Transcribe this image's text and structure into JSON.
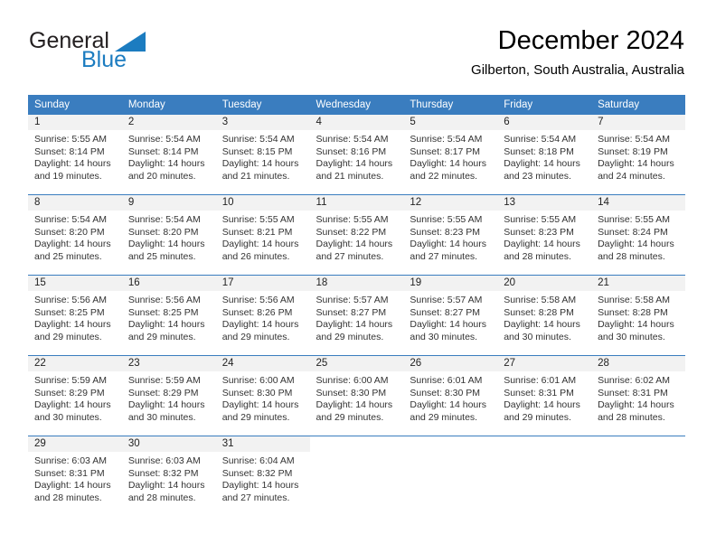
{
  "brand": {
    "name_part1": "General",
    "name_part2": "Blue",
    "triangle_color": "#1c7cc0",
    "text_color": "#231f20"
  },
  "header": {
    "title": "December 2024",
    "location": "Gilberton, South Australia, Australia"
  },
  "theme": {
    "header_bg": "#3a7dbf",
    "header_text": "#ffffff",
    "daynum_bg": "#f2f2f2",
    "row_divider": "#3a7dbf",
    "body_text": "#333333"
  },
  "weekday_headers": [
    "Sunday",
    "Monday",
    "Tuesday",
    "Wednesday",
    "Thursday",
    "Friday",
    "Saturday"
  ],
  "labels": {
    "sunrise_prefix": "Sunrise:",
    "sunset_prefix": "Sunset:",
    "daylight_prefix": "Daylight:"
  },
  "weeks": [
    {
      "days": [
        {
          "num": "1",
          "sunrise": "Sunrise: 5:55 AM",
          "sunset": "Sunset: 8:14 PM",
          "daylight_l1": "Daylight: 14 hours",
          "daylight_l2": "and 19 minutes."
        },
        {
          "num": "2",
          "sunrise": "Sunrise: 5:54 AM",
          "sunset": "Sunset: 8:14 PM",
          "daylight_l1": "Daylight: 14 hours",
          "daylight_l2": "and 20 minutes."
        },
        {
          "num": "3",
          "sunrise": "Sunrise: 5:54 AM",
          "sunset": "Sunset: 8:15 PM",
          "daylight_l1": "Daylight: 14 hours",
          "daylight_l2": "and 21 minutes."
        },
        {
          "num": "4",
          "sunrise": "Sunrise: 5:54 AM",
          "sunset": "Sunset: 8:16 PM",
          "daylight_l1": "Daylight: 14 hours",
          "daylight_l2": "and 21 minutes."
        },
        {
          "num": "5",
          "sunrise": "Sunrise: 5:54 AM",
          "sunset": "Sunset: 8:17 PM",
          "daylight_l1": "Daylight: 14 hours",
          "daylight_l2": "and 22 minutes."
        },
        {
          "num": "6",
          "sunrise": "Sunrise: 5:54 AM",
          "sunset": "Sunset: 8:18 PM",
          "daylight_l1": "Daylight: 14 hours",
          "daylight_l2": "and 23 minutes."
        },
        {
          "num": "7",
          "sunrise": "Sunrise: 5:54 AM",
          "sunset": "Sunset: 8:19 PM",
          "daylight_l1": "Daylight: 14 hours",
          "daylight_l2": "and 24 minutes."
        }
      ]
    },
    {
      "days": [
        {
          "num": "8",
          "sunrise": "Sunrise: 5:54 AM",
          "sunset": "Sunset: 8:20 PM",
          "daylight_l1": "Daylight: 14 hours",
          "daylight_l2": "and 25 minutes."
        },
        {
          "num": "9",
          "sunrise": "Sunrise: 5:54 AM",
          "sunset": "Sunset: 8:20 PM",
          "daylight_l1": "Daylight: 14 hours",
          "daylight_l2": "and 25 minutes."
        },
        {
          "num": "10",
          "sunrise": "Sunrise: 5:55 AM",
          "sunset": "Sunset: 8:21 PM",
          "daylight_l1": "Daylight: 14 hours",
          "daylight_l2": "and 26 minutes."
        },
        {
          "num": "11",
          "sunrise": "Sunrise: 5:55 AM",
          "sunset": "Sunset: 8:22 PM",
          "daylight_l1": "Daylight: 14 hours",
          "daylight_l2": "and 27 minutes."
        },
        {
          "num": "12",
          "sunrise": "Sunrise: 5:55 AM",
          "sunset": "Sunset: 8:23 PM",
          "daylight_l1": "Daylight: 14 hours",
          "daylight_l2": "and 27 minutes."
        },
        {
          "num": "13",
          "sunrise": "Sunrise: 5:55 AM",
          "sunset": "Sunset: 8:23 PM",
          "daylight_l1": "Daylight: 14 hours",
          "daylight_l2": "and 28 minutes."
        },
        {
          "num": "14",
          "sunrise": "Sunrise: 5:55 AM",
          "sunset": "Sunset: 8:24 PM",
          "daylight_l1": "Daylight: 14 hours",
          "daylight_l2": "and 28 minutes."
        }
      ]
    },
    {
      "days": [
        {
          "num": "15",
          "sunrise": "Sunrise: 5:56 AM",
          "sunset": "Sunset: 8:25 PM",
          "daylight_l1": "Daylight: 14 hours",
          "daylight_l2": "and 29 minutes."
        },
        {
          "num": "16",
          "sunrise": "Sunrise: 5:56 AM",
          "sunset": "Sunset: 8:25 PM",
          "daylight_l1": "Daylight: 14 hours",
          "daylight_l2": "and 29 minutes."
        },
        {
          "num": "17",
          "sunrise": "Sunrise: 5:56 AM",
          "sunset": "Sunset: 8:26 PM",
          "daylight_l1": "Daylight: 14 hours",
          "daylight_l2": "and 29 minutes."
        },
        {
          "num": "18",
          "sunrise": "Sunrise: 5:57 AM",
          "sunset": "Sunset: 8:27 PM",
          "daylight_l1": "Daylight: 14 hours",
          "daylight_l2": "and 29 minutes."
        },
        {
          "num": "19",
          "sunrise": "Sunrise: 5:57 AM",
          "sunset": "Sunset: 8:27 PM",
          "daylight_l1": "Daylight: 14 hours",
          "daylight_l2": "and 30 minutes."
        },
        {
          "num": "20",
          "sunrise": "Sunrise: 5:58 AM",
          "sunset": "Sunset: 8:28 PM",
          "daylight_l1": "Daylight: 14 hours",
          "daylight_l2": "and 30 minutes."
        },
        {
          "num": "21",
          "sunrise": "Sunrise: 5:58 AM",
          "sunset": "Sunset: 8:28 PM",
          "daylight_l1": "Daylight: 14 hours",
          "daylight_l2": "and 30 minutes."
        }
      ]
    },
    {
      "days": [
        {
          "num": "22",
          "sunrise": "Sunrise: 5:59 AM",
          "sunset": "Sunset: 8:29 PM",
          "daylight_l1": "Daylight: 14 hours",
          "daylight_l2": "and 30 minutes."
        },
        {
          "num": "23",
          "sunrise": "Sunrise: 5:59 AM",
          "sunset": "Sunset: 8:29 PM",
          "daylight_l1": "Daylight: 14 hours",
          "daylight_l2": "and 30 minutes."
        },
        {
          "num": "24",
          "sunrise": "Sunrise: 6:00 AM",
          "sunset": "Sunset: 8:30 PM",
          "daylight_l1": "Daylight: 14 hours",
          "daylight_l2": "and 29 minutes."
        },
        {
          "num": "25",
          "sunrise": "Sunrise: 6:00 AM",
          "sunset": "Sunset: 8:30 PM",
          "daylight_l1": "Daylight: 14 hours",
          "daylight_l2": "and 29 minutes."
        },
        {
          "num": "26",
          "sunrise": "Sunrise: 6:01 AM",
          "sunset": "Sunset: 8:30 PM",
          "daylight_l1": "Daylight: 14 hours",
          "daylight_l2": "and 29 minutes."
        },
        {
          "num": "27",
          "sunrise": "Sunrise: 6:01 AM",
          "sunset": "Sunset: 8:31 PM",
          "daylight_l1": "Daylight: 14 hours",
          "daylight_l2": "and 29 minutes."
        },
        {
          "num": "28",
          "sunrise": "Sunrise: 6:02 AM",
          "sunset": "Sunset: 8:31 PM",
          "daylight_l1": "Daylight: 14 hours",
          "daylight_l2": "and 28 minutes."
        }
      ]
    },
    {
      "days": [
        {
          "num": "29",
          "sunrise": "Sunrise: 6:03 AM",
          "sunset": "Sunset: 8:31 PM",
          "daylight_l1": "Daylight: 14 hours",
          "daylight_l2": "and 28 minutes."
        },
        {
          "num": "30",
          "sunrise": "Sunrise: 6:03 AM",
          "sunset": "Sunset: 8:32 PM",
          "daylight_l1": "Daylight: 14 hours",
          "daylight_l2": "and 28 minutes."
        },
        {
          "num": "31",
          "sunrise": "Sunrise: 6:04 AM",
          "sunset": "Sunset: 8:32 PM",
          "daylight_l1": "Daylight: 14 hours",
          "daylight_l2": "and 27 minutes."
        },
        {
          "num": "",
          "sunrise": "",
          "sunset": "",
          "daylight_l1": "",
          "daylight_l2": ""
        },
        {
          "num": "",
          "sunrise": "",
          "sunset": "",
          "daylight_l1": "",
          "daylight_l2": ""
        },
        {
          "num": "",
          "sunrise": "",
          "sunset": "",
          "daylight_l1": "",
          "daylight_l2": ""
        },
        {
          "num": "",
          "sunrise": "",
          "sunset": "",
          "daylight_l1": "",
          "daylight_l2": ""
        }
      ]
    }
  ]
}
